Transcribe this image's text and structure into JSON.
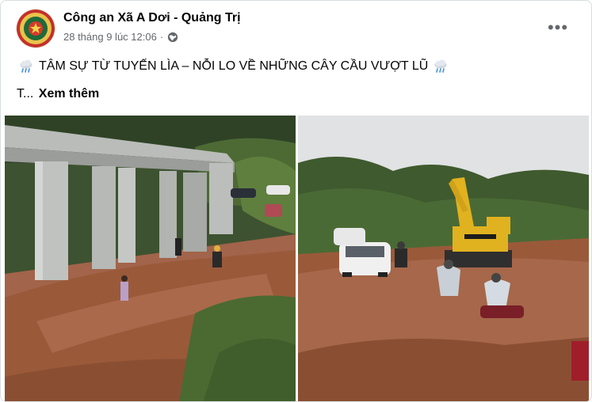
{
  "post": {
    "author": "Công an Xã A Dơi - Quảng Trị",
    "timestamp": "28 tháng 9 lúc 12:06",
    "separator": "·",
    "privacy_icon": "globe-icon",
    "more_icon": "more-options-icon",
    "more_label": "•••",
    "headline": "TÂM SỰ TỪ TUYẾN LÌA – NỖI LO VỀ NHỮNG CÂY CẦU VƯỢT LŨ",
    "headline_icon": "rain-cloud-icon",
    "body_preview": "T...",
    "see_more": "Xem thêm"
  },
  "photos": [
    {
      "name": "bridge-pillars-muddy-road-photo"
    },
    {
      "name": "excavator-flooded-road-photo"
    }
  ],
  "colors": {
    "text_primary": "#050505",
    "text_secondary": "#65676b",
    "mud": "#9a5a3a",
    "sky": "#d8dadb",
    "foliage": "#3f5a2e"
  }
}
